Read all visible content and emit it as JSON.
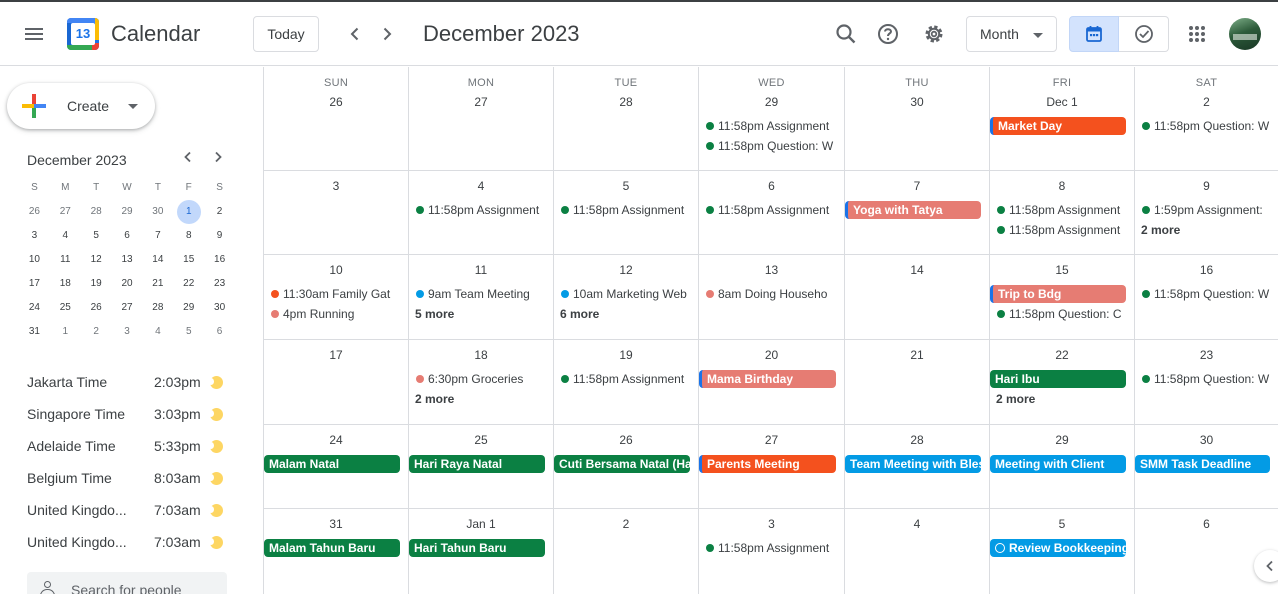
{
  "header": {
    "app_name": "Calendar",
    "logo_day": "13",
    "today_label": "Today",
    "prev_icon": "chevron-left-icon",
    "next_icon": "chevron-right-icon",
    "title": "December 2023",
    "view_label": "Month"
  },
  "sidebar": {
    "create_label": "Create",
    "mini_title": "December 2023",
    "mini_dows": [
      "S",
      "M",
      "T",
      "W",
      "T",
      "F",
      "S"
    ],
    "mini_weeks": [
      [
        "26",
        "27",
        "28",
        "29",
        "30",
        "1",
        "2"
      ],
      [
        "3",
        "4",
        "5",
        "6",
        "7",
        "8",
        "9"
      ],
      [
        "10",
        "11",
        "12",
        "13",
        "14",
        "15",
        "16"
      ],
      [
        "17",
        "18",
        "19",
        "20",
        "21",
        "22",
        "23"
      ],
      [
        "24",
        "25",
        "26",
        "27",
        "28",
        "29",
        "30"
      ],
      [
        "31",
        "1",
        "2",
        "3",
        "4",
        "5",
        "6"
      ]
    ],
    "mini_selected": "1",
    "clocks": [
      {
        "name": "Jakarta Time",
        "time": "2:03pm"
      },
      {
        "name": "Singapore Time",
        "time": "3:03pm"
      },
      {
        "name": "Adelaide Time",
        "time": "5:33pm"
      },
      {
        "name": "Belgium Time",
        "time": "8:03am"
      },
      {
        "name": "United Kingdo...",
        "time": "7:03am"
      },
      {
        "name": "United Kingdo...",
        "time": "7:03am"
      }
    ],
    "people_search_placeholder": "Search for people"
  },
  "colors": {
    "green": "#0b8043",
    "blue": "#039be5",
    "orange": "#f4511e",
    "pink": "#e67c73",
    "selected_blue": "#1a73e8"
  },
  "calendar": {
    "dows": [
      "SUN",
      "MON",
      "TUE",
      "WED",
      "THU",
      "FRI",
      "SAT"
    ],
    "weeks": [
      {
        "days": [
          {
            "label": "26",
            "events": []
          },
          {
            "label": "27",
            "events": []
          },
          {
            "label": "28",
            "events": []
          },
          {
            "label": "29",
            "events": [
              {
                "kind": "dot",
                "color": "green",
                "time": "11:58pm",
                "title": "Assignment"
              },
              {
                "kind": "dot",
                "color": "green",
                "time": "11:58pm",
                "title": "Question: W"
              }
            ]
          },
          {
            "label": "30",
            "events": []
          },
          {
            "label": "Dec 1",
            "events": [
              {
                "kind": "chip",
                "color": "orange",
                "edge": true,
                "title": "Market Day"
              }
            ]
          },
          {
            "label": "2",
            "events": [
              {
                "kind": "dot",
                "color": "green",
                "time": "11:58pm",
                "title": "Question: W"
              }
            ]
          }
        ]
      },
      {
        "days": [
          {
            "label": "3",
            "events": []
          },
          {
            "label": "4",
            "events": [
              {
                "kind": "dot",
                "color": "green",
                "time": "11:58pm",
                "title": "Assignment"
              }
            ]
          },
          {
            "label": "5",
            "events": [
              {
                "kind": "dot",
                "color": "green",
                "time": "11:58pm",
                "title": "Assignment"
              }
            ]
          },
          {
            "label": "6",
            "events": [
              {
                "kind": "dot",
                "color": "green",
                "time": "11:58pm",
                "title": "Assignment"
              }
            ]
          },
          {
            "label": "7",
            "events": [
              {
                "kind": "chip",
                "color": "pink",
                "edge": true,
                "title": "Yoga with Tatya"
              }
            ]
          },
          {
            "label": "8",
            "events": [
              {
                "kind": "dot",
                "color": "green",
                "time": "11:58pm",
                "title": "Assignment"
              },
              {
                "kind": "dot",
                "color": "green",
                "time": "11:58pm",
                "title": "Assignment"
              }
            ]
          },
          {
            "label": "9",
            "events": [
              {
                "kind": "dot",
                "color": "green",
                "time": "1:59pm",
                "title": "Assignment:"
              },
              {
                "kind": "more",
                "title": "2 more"
              }
            ]
          }
        ]
      },
      {
        "days": [
          {
            "label": "10",
            "events": [
              {
                "kind": "dot",
                "color": "orange",
                "time": "11:30am",
                "title": "Family Gat"
              },
              {
                "kind": "dot",
                "color": "pink",
                "time": "4pm",
                "title": "Running"
              }
            ]
          },
          {
            "label": "11",
            "events": [
              {
                "kind": "dot",
                "color": "blue",
                "time": "9am",
                "title": "Team Meeting"
              },
              {
                "kind": "more",
                "title": "5 more"
              }
            ]
          },
          {
            "label": "12",
            "events": [
              {
                "kind": "dot",
                "color": "blue",
                "time": "10am",
                "title": "Marketing Web"
              },
              {
                "kind": "more",
                "title": "6 more"
              }
            ]
          },
          {
            "label": "13",
            "events": [
              {
                "kind": "dot",
                "color": "pink",
                "time": "8am",
                "title": "Doing Househo"
              }
            ]
          },
          {
            "label": "14",
            "events": []
          },
          {
            "label": "15",
            "events": [
              {
                "kind": "chip",
                "color": "pink",
                "edge": true,
                "title": "Trip to Bdg"
              },
              {
                "kind": "dot",
                "color": "green",
                "time": "11:58pm",
                "title": "Question: C"
              }
            ]
          },
          {
            "label": "16",
            "events": [
              {
                "kind": "dot",
                "color": "green",
                "time": "11:58pm",
                "title": "Question: W"
              }
            ]
          }
        ]
      },
      {
        "days": [
          {
            "label": "17",
            "events": []
          },
          {
            "label": "18",
            "events": [
              {
                "kind": "dot",
                "color": "pink",
                "time": "6:30pm",
                "title": "Groceries"
              },
              {
                "kind": "more",
                "title": "2 more"
              }
            ]
          },
          {
            "label": "19",
            "events": [
              {
                "kind": "dot",
                "color": "green",
                "time": "11:58pm",
                "title": "Assignment"
              }
            ]
          },
          {
            "label": "20",
            "events": [
              {
                "kind": "chip",
                "color": "pink",
                "edge": true,
                "title": "Mama Birthday"
              }
            ]
          },
          {
            "label": "21",
            "events": []
          },
          {
            "label": "22",
            "events": [
              {
                "kind": "chip",
                "color": "green",
                "edge": false,
                "title": "Hari Ibu"
              },
              {
                "kind": "more",
                "title": "2 more"
              }
            ]
          },
          {
            "label": "23",
            "events": [
              {
                "kind": "dot",
                "color": "green",
                "time": "11:58pm",
                "title": "Question: W"
              }
            ]
          }
        ]
      },
      {
        "days": [
          {
            "label": "24",
            "events": [
              {
                "kind": "chip",
                "color": "green",
                "edge": false,
                "title": "Malam Natal"
              }
            ]
          },
          {
            "label": "25",
            "events": [
              {
                "kind": "chip",
                "color": "green",
                "edge": false,
                "title": "Hari Raya Natal"
              }
            ]
          },
          {
            "label": "26",
            "events": [
              {
                "kind": "chip",
                "color": "green",
                "edge": false,
                "title": "Cuti Bersama Natal (Ha"
              }
            ]
          },
          {
            "label": "27",
            "events": [
              {
                "kind": "chip",
                "color": "orange",
                "edge": true,
                "title": "Parents Meeting"
              }
            ]
          },
          {
            "label": "28",
            "events": [
              {
                "kind": "chip",
                "color": "blue",
                "edge": false,
                "title": "Team Meeting with Bles"
              }
            ]
          },
          {
            "label": "29",
            "events": [
              {
                "kind": "chip",
                "color": "blue",
                "edge": false,
                "title": "Meeting with Client"
              }
            ]
          },
          {
            "label": "30",
            "events": [
              {
                "kind": "chip",
                "color": "blue",
                "edge": false,
                "title": "SMM Task Deadline"
              }
            ]
          }
        ]
      },
      {
        "days": [
          {
            "label": "31",
            "events": [
              {
                "kind": "chip",
                "color": "green",
                "edge": false,
                "title": "Malam Tahun Baru"
              }
            ]
          },
          {
            "label": "Jan 1",
            "events": [
              {
                "kind": "chip",
                "color": "green",
                "edge": false,
                "title": "Hari Tahun Baru"
              }
            ]
          },
          {
            "label": "2",
            "events": []
          },
          {
            "label": "3",
            "events": [
              {
                "kind": "dot",
                "color": "green",
                "time": "11:58pm",
                "title": "Assignment"
              }
            ]
          },
          {
            "label": "4",
            "events": []
          },
          {
            "label": "5",
            "events": [
              {
                "kind": "chip",
                "color": "blue",
                "edge": false,
                "task": true,
                "title": "Review Bookkeeping"
              }
            ]
          },
          {
            "label": "6",
            "events": []
          }
        ]
      }
    ]
  }
}
